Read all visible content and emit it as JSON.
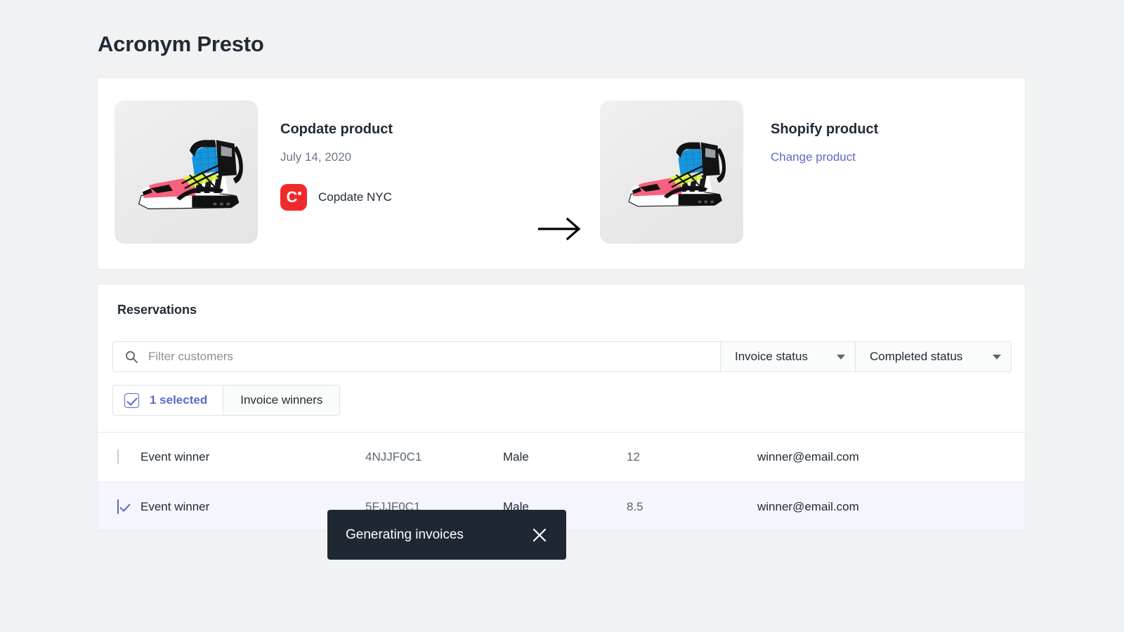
{
  "page": {
    "title": "Acronym Presto",
    "background": "#f1f2f4"
  },
  "colors": {
    "accent": "#5c6ac4",
    "brand_red": "#f02a2a",
    "toast_bg": "#1f2733",
    "text": "#212b36"
  },
  "product_card": {
    "source": {
      "heading": "Copdate product",
      "date": "July 14, 2020",
      "brand_name": "Copdate NYC",
      "logo_letter": "C",
      "image_alt": "nike-presto-sneaker"
    },
    "arrow_icon": "arrow-right-icon",
    "target": {
      "heading": "Shopify product",
      "change_link": "Change product",
      "image_alt": "nike-presto-sneaker"
    }
  },
  "reservations": {
    "title": "Reservations",
    "search": {
      "placeholder": "Filter customers",
      "value": "",
      "icon": "search-icon"
    },
    "filters": [
      {
        "label": "Invoice status",
        "icon": "chevron-down-icon"
      },
      {
        "label": "Completed status",
        "icon": "chevron-down-icon"
      }
    ],
    "selection": {
      "count_label": "1 selected",
      "action_label": "Invoice winners",
      "checked": true
    },
    "rows": [
      {
        "checked": false,
        "name": "Event winner",
        "code": "4NJJF0C1",
        "gender": "Male",
        "size": "12",
        "email": "winner@email.com"
      },
      {
        "checked": true,
        "name": "Event winner",
        "code": "5FJJF0C1",
        "gender": "Male",
        "size": "8.5",
        "email": "winner@email.com"
      }
    ]
  },
  "toast": {
    "message": "Generating invoices",
    "close_icon": "close-icon"
  }
}
